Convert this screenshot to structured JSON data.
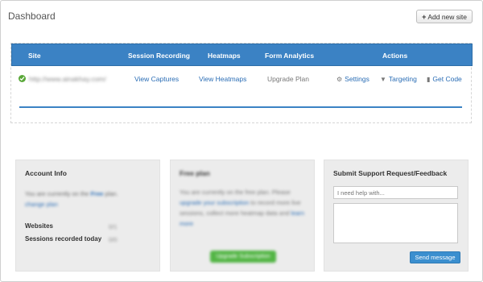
{
  "header": {
    "title": "Dashboard",
    "add_site_label": "Add new site",
    "add_site_icon": "plus-icon"
  },
  "sites_table": {
    "columns": [
      "Site",
      "Session Recording",
      "Heatmaps",
      "Form Analytics",
      "Actions"
    ],
    "header_color": "#3b82c4",
    "rows": [
      {
        "status_icon": "check-circle-icon",
        "site": "http://www.ainakhay.com/",
        "session_recording": "View Captures",
        "heatmaps": "View Heatmaps",
        "form_analytics": "Upgrade Plan",
        "actions": {
          "settings": "Settings",
          "targeting": "Targeting",
          "get_code": "Get Code"
        }
      }
    ]
  },
  "account_info": {
    "title": "Account Info",
    "plan_text": "You are currently on the",
    "plan_name": "Free",
    "plan_suffix": "plan.",
    "change_plan": "change plan",
    "stats": [
      {
        "label": "Websites",
        "value": "0/1"
      },
      {
        "label": "Sessions recorded today",
        "value": "0/0"
      }
    ]
  },
  "free_plan": {
    "title": "Free plan",
    "text_before_link": "You are currently on the free plan. Please",
    "link_text": "upgrade your subscription",
    "text_after_link": "to record more live sessions, collect more heatmap data and",
    "learn_more": "learn more",
    "upgrade_button": "Upgrade Subscription"
  },
  "support": {
    "title": "Submit Support Request/Feedback",
    "input_placeholder": "I need help with...",
    "send_button": "Send message",
    "button_color": "#3b8fcf"
  }
}
